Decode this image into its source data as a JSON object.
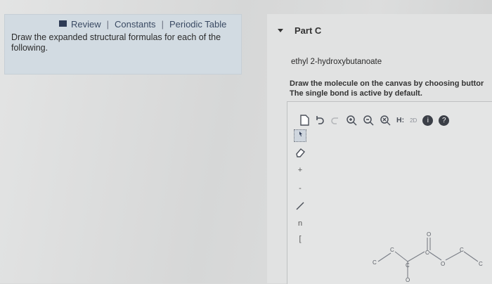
{
  "header": {
    "review": "Review",
    "separator": "|",
    "constants": "Constants",
    "periodic_table": "Periodic Table"
  },
  "instructions": "Draw the expanded structural formulas for each of the following.",
  "part": {
    "label": "Part C",
    "compound_name": "ethyl 2-hydroxybutanoate",
    "draw_line1": "Draw the molecule on the canvas by choosing buttor",
    "draw_line2": "The single bond is active by default."
  },
  "toolbar": {
    "h_label": "H:",
    "small_label": "2D",
    "info_label": "i",
    "help_label": "?"
  },
  "sidebar": {
    "plus_label": "+",
    "minus_label": "-",
    "bracket_label": "[",
    "chain_label": "n"
  },
  "molecule": {
    "atoms": [
      "C",
      "C",
      "C",
      "C",
      "O",
      "O",
      "C",
      "C",
      "O"
    ]
  },
  "colors": {
    "link": "#3a4a63",
    "panel": "#d2dbe2",
    "bond": "#7a7e86"
  }
}
